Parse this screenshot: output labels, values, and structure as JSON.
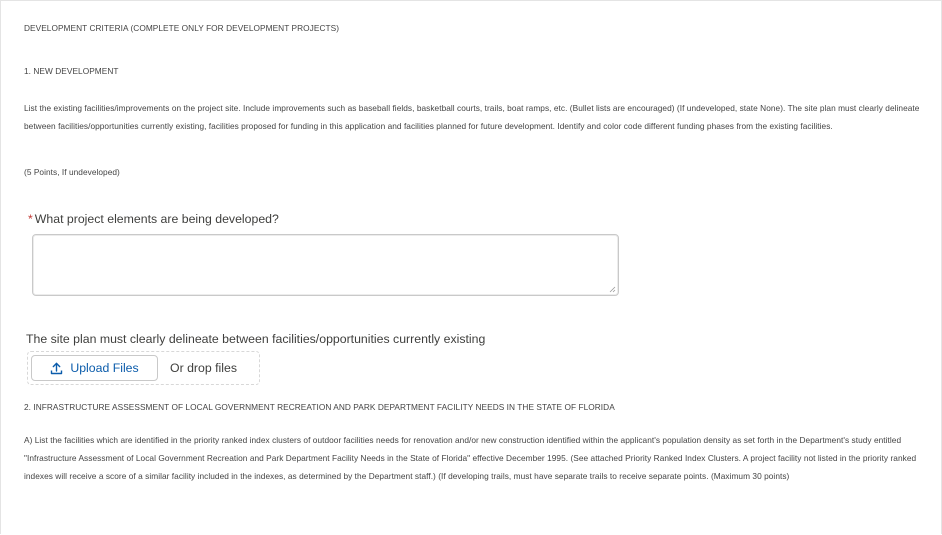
{
  "section": {
    "title": "DEVELOPMENT CRITERIA (COMPLETE ONLY FOR DEVELOPMENT PROJECTS)",
    "subsection1_title": "1. NEW DEVELOPMENT",
    "subsection1_text": "List the existing facilities/improvements on the project site. Include improvements such as baseball fields, basketball courts, trails, boat ramps, etc. (Bullet lists are encouraged) (If undeveloped, state None). The site plan must clearly delineate between facilities/opportunities currently existing, facilities proposed for funding in this application and facilities planned for future development. Identify and color code different funding phases from the existing facilities.",
    "subsection1_points": "(5 Points, If undeveloped)"
  },
  "question": {
    "required_marker": "*",
    "label": "What project elements are being developed?",
    "value": ""
  },
  "upload": {
    "label": "The site plan must clearly delineate between facilities/opportunities currently existing",
    "button_label": "Upload Files",
    "drop_text": "Or drop files"
  },
  "section2": {
    "title": "2. INFRASTRUCTURE ASSESSMENT OF LOCAL GOVERNMENT RECREATION AND PARK DEPARTMENT FACILITY NEEDS IN THE STATE OF FLORIDA",
    "text": "A) List the facilities which are identified in the priority ranked index clusters of outdoor facilities needs for renovation and/or new construction identified within the applicant's population density as set forth in the Department's study entitled \"Infrastructure Assessment of Local Government Recreation and Park Department Facility Needs in the State of Florida\" effective December 1995. (See attached Priority Ranked Index Clusters. A project facility not listed in the priority ranked indexes will receive a score of a similar facility included in the indexes, as determined by the Department staff.) (If developing trails, must have separate trails to receive separate points. (Maximum 30 points)"
  },
  "colors": {
    "link_blue": "#0b5cab",
    "required_red": "#c23934",
    "text": "#3e3e3c",
    "border": "#c9c9c9"
  },
  "icons": {
    "upload": "upload-icon",
    "resize": "resize-handle-icon"
  }
}
